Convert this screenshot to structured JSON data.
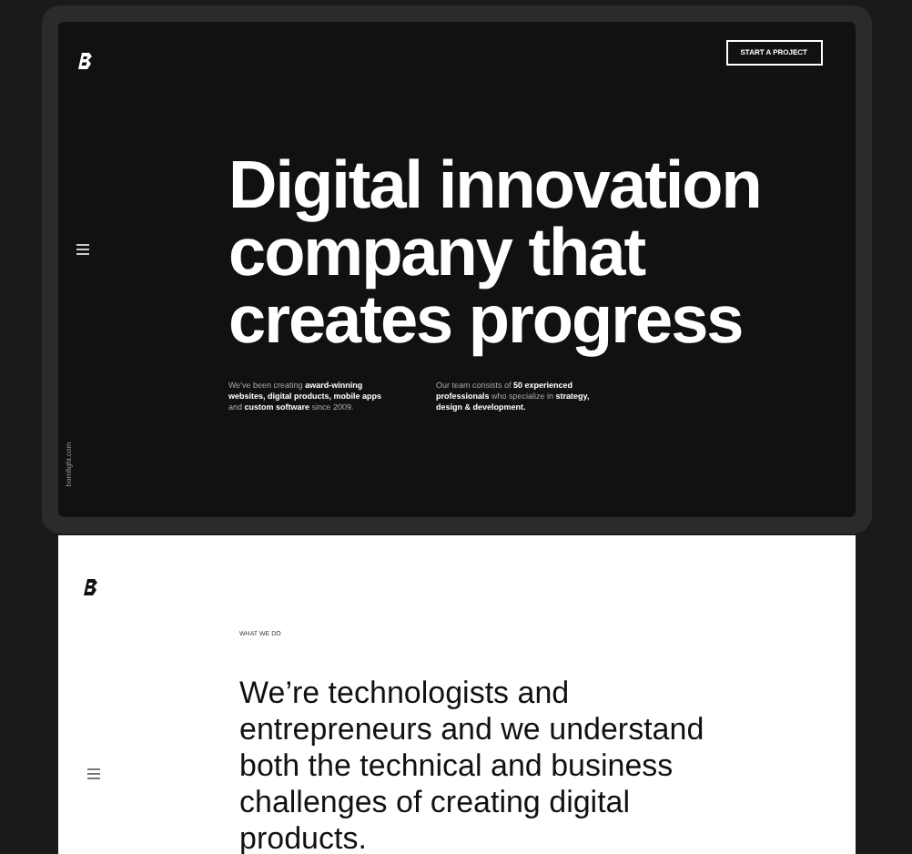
{
  "hero": {
    "button": "START A PROJECT",
    "headline": [
      "Digital innovation",
      "company that",
      "creates progress"
    ],
    "paragraphs": [
      "We've been creating **award-winning websites, digital products, mobile apps** and **custom software** since 2009.",
      "Our team consists of **50 experienced professionals** who specialize in **strategy, design & development.**"
    ],
    "side_text": "bornfight.com"
  },
  "section": {
    "eyebrow": "WHAT WE DO",
    "statement": "We’re technologists and entrepreneurs and we understand both the technical and business challenges of creating digital products."
  }
}
